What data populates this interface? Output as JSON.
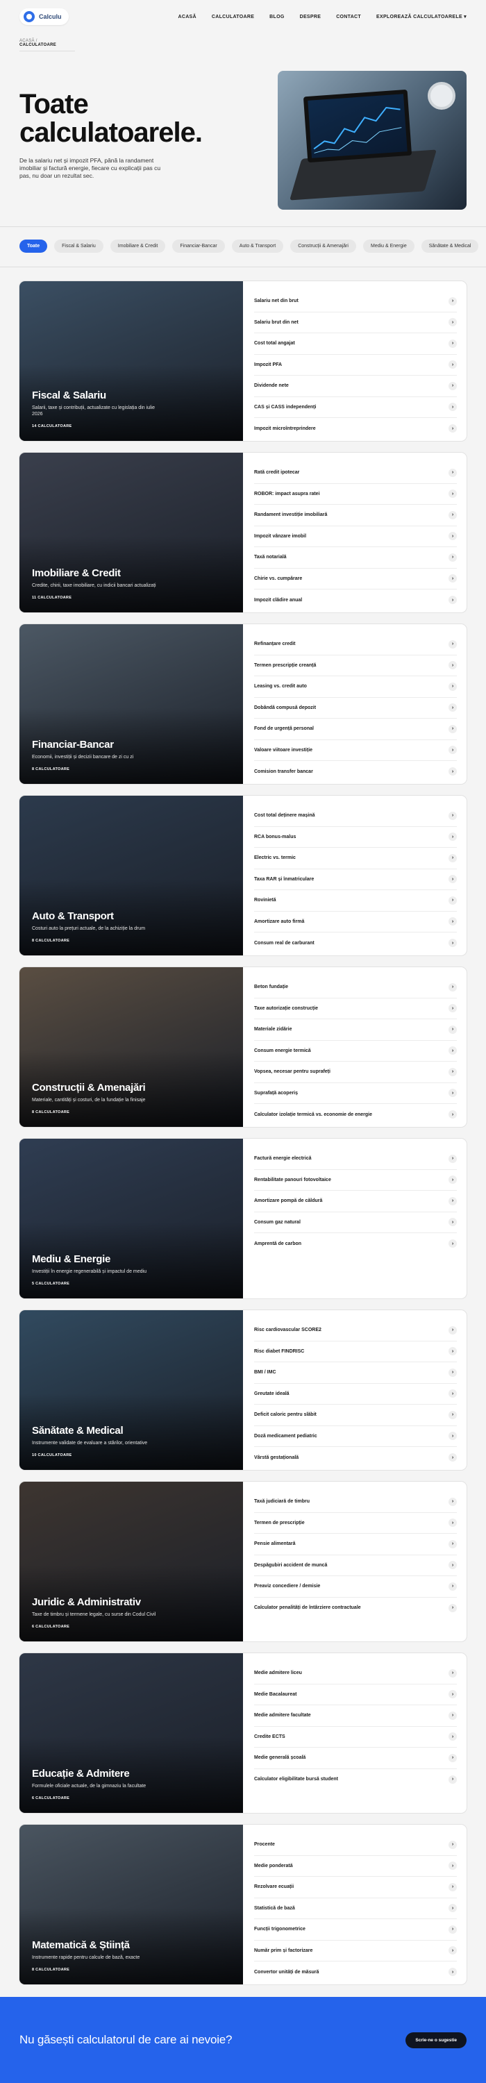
{
  "header": {
    "logo_text": "Calculu",
    "nav": [
      "ACASĂ",
      "CALCULATOARE",
      "BLOG",
      "DESPRE",
      "CONTACT"
    ],
    "explore": "EXPLOREAZĂ CALCULATOARELE"
  },
  "breadcrumb": {
    "home": "ACASĂ",
    "current": "CALCULATOARE"
  },
  "hero": {
    "title": "Toate calculatoarele.",
    "description": "De la salariu net și impozit PFA, până la randament imobiliar și factură energie, fiecare cu explicații pas cu pas, nu doar un rezultat sec."
  },
  "chips": [
    "Toate",
    "Fiscal & Salariu",
    "Imobiliare & Credit",
    "Financiar-Bancar",
    "Auto & Transport",
    "Construcții & Amenajări",
    "Mediu & Energie",
    "Sănătate & Medical"
  ],
  "categories": [
    {
      "title": "Fiscal & Salariu",
      "desc": "Salarii, taxe și contribuții, actualizate cu legislația din iulie 2026",
      "count": "14 CALCULATOARE",
      "bg": "#3b4f63",
      "items": [
        "Salariu net din brut",
        "Salariu brut din net",
        "Cost total angajat",
        "Impozit PFA",
        "Dividende nete",
        "CAS și CASS independenți",
        "Impozit microîntreprindere"
      ]
    },
    {
      "title": "Imobiliare & Credit",
      "desc": "Credite, chirii, taxe imobiliare, cu indicii bancari actualizați",
      "count": "11 CALCULATOARE",
      "bg": "#3a3f4c",
      "items": [
        "Rată credit ipotecar",
        "ROBOR: impact asupra ratei",
        "Randament investiție imobiliară",
        "Impozit vânzare imobil",
        "Taxă notarială",
        "Chirie vs. cumpărare",
        "Impozit clădire anual"
      ]
    },
    {
      "title": "Financiar-Bancar",
      "desc": "Economii, investiții și decizii bancare de zi cu zi",
      "count": "8 CALCULATOARE",
      "bg": "#4c5864",
      "items": [
        "Refinanțare credit",
        "Termen prescripție creanță",
        "Leasing vs. credit auto",
        "Dobândă compusă depozit",
        "Fond de urgență personal",
        "Valoare viitoare investiție",
        "Comision transfer bancar"
      ]
    },
    {
      "title": "Auto & Transport",
      "desc": "Costuri auto la prețuri actuale, de la achiziție la drum",
      "count": "8 CALCULATOARE",
      "bg": "#2c3a4c",
      "items": [
        "Cost total deținere mașină",
        "RCA bonus-malus",
        "Electric vs. termic",
        "Taxa RAR și înmatriculare",
        "Rovinietă",
        "Amortizare auto firmă",
        "Consum real de carburant"
      ]
    },
    {
      "title": "Construcții & Amenajări",
      "desc": "Materiale, cantități și costuri, de la fundație la finisaje",
      "count": "8 CALCULATOARE",
      "bg": "#5a4e42",
      "items": [
        "Beton fundație",
        "Taxe autorizație construcție",
        "Materiale zidărie",
        "Consum energie termică",
        "Vopsea, necesar pentru suprafeți",
        "Suprafață acoperiș",
        "Calculator izolație termică vs. economie de energie"
      ]
    },
    {
      "title": "Mediu & Energie",
      "desc": "Investiții în energie regenerabilă și impactul de mediu",
      "count": "5 CALCULATOARE",
      "bg": "#2f3d52",
      "items": [
        "Factură energie electrică",
        "Rentabilitate panouri fotovoltaice",
        "Amortizare pompă de căldură",
        "Consum gaz natural",
        "Amprentă de carbon"
      ]
    },
    {
      "title": "Sănătate & Medical",
      "desc": "Instrumente validate de evaluare a stărilor, orientative",
      "count": "10 CALCULATOARE",
      "bg": "#314a5f",
      "items": [
        "Risc cardiovascular SCORE2",
        "Risc diabet FINDRISC",
        "BMI / IMC",
        "Greutate ideală",
        "Deficit caloric pentru slăbit",
        "Doză medicament pediatric",
        "Vârstă gestațională"
      ]
    },
    {
      "title": "Juridic & Administrativ",
      "desc": "Taxe de timbru și termene legale, cu surse din Codul Civil",
      "count": "6 CALCULATOARE",
      "bg": "#3d3530",
      "items": [
        "Taxă judiciară de timbru",
        "Termen de prescripție",
        "Pensie alimentară",
        "Despăgubiri accident de muncă",
        "Preaviz concediere / demisie",
        "Calculator penalități de întârziere contractuale"
      ]
    },
    {
      "title": "Educație & Admitere",
      "desc": "Formulele oficiale actuale, de la gimnaziu la facultate",
      "count": "6 CALCULATOARE",
      "bg": "#2e3746",
      "items": [
        "Medie admitere liceu",
        "Medie Bacalaureat",
        "Medie admitere facultate",
        "Credite ECTS",
        "Medie generală școală",
        "Calculator eligibilitate bursă student"
      ]
    },
    {
      "title": "Matematică & Știință",
      "desc": "Instrumente rapide pentru calcule de bază, exacte",
      "count": "8 CALCULATOARE",
      "bg": "#4a5560",
      "items": [
        "Procente",
        "Medie ponderată",
        "Rezolvare ecuații",
        "Statistică de bază",
        "Funcții trigonometrice",
        "Număr prim și factorizare",
        "Convertor unități de măsură"
      ]
    }
  ],
  "cta": {
    "title": "Nu găsești calculatorul de care ai nevoie?",
    "button": "Scrie-ne o sugestie"
  },
  "colors": {
    "accent": "#2563eb",
    "dark": "#0f1420"
  }
}
